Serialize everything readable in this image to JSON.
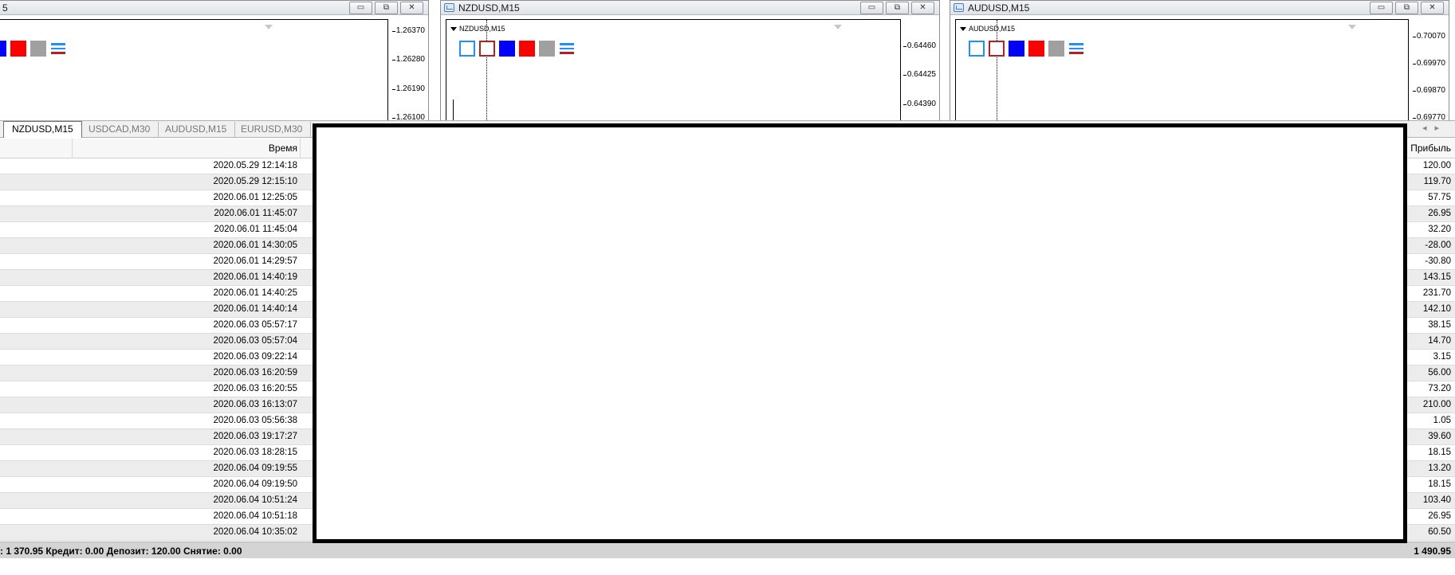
{
  "chart_windows": [
    {
      "title": "5",
      "label": "",
      "prices": [
        "1.26370",
        "1.26280",
        "1.26190",
        "1.26100"
      ]
    },
    {
      "title": "NZDUSD,M15",
      "label": "NZDUSD,M15",
      "prices": [
        "0.64460",
        "0.64425",
        "0.64390"
      ]
    },
    {
      "title": "AUDUSD,M15",
      "label": "AUDUSD,M15",
      "prices": [
        "0.70070",
        "0.69970",
        "0.69870",
        "0.69770"
      ]
    }
  ],
  "window_buttons": {
    "minimize": "▭",
    "restore": "⧉",
    "close": "✕"
  },
  "tabs": [
    {
      "label": "NZDUSD,M15",
      "active": true
    },
    {
      "label": "USDCAD,M30",
      "active": false
    },
    {
      "label": "AUDUSD,M15",
      "active": false
    },
    {
      "label": "EURUSD,M30",
      "active": false
    }
  ],
  "tab_scroll": {
    "left": "◂",
    "right": "▸"
  },
  "table": {
    "headers": {
      "time": "Время",
      "profit": "Прибыль"
    },
    "rows": [
      {
        "time": "2020.05.29 12:14:18",
        "profit": "120.00"
      },
      {
        "time": "2020.05.29 12:15:10",
        "profit": "119.70"
      },
      {
        "time": "2020.06.01 12:25:05",
        "profit": "57.75"
      },
      {
        "time": "2020.06.01 11:45:07",
        "profit": "26.95"
      },
      {
        "time": "2020.06.01 11:45:04",
        "profit": "32.20"
      },
      {
        "time": "2020.06.01 14:30:05",
        "profit": "-28.00"
      },
      {
        "time": "2020.06.01 14:29:57",
        "profit": "-30.80"
      },
      {
        "time": "2020.06.01 14:40:19",
        "profit": "143.15"
      },
      {
        "time": "2020.06.01 14:40:25",
        "profit": "231.70"
      },
      {
        "time": "2020.06.01 14:40:14",
        "profit": "142.10"
      },
      {
        "time": "2020.06.03 05:57:17",
        "profit": "38.15"
      },
      {
        "time": "2020.06.03 05:57:04",
        "profit": "14.70"
      },
      {
        "time": "2020.06.03 09:22:14",
        "profit": "3.15"
      },
      {
        "time": "2020.06.03 16:20:59",
        "profit": "56.00"
      },
      {
        "time": "2020.06.03 16:20:55",
        "profit": "73.20"
      },
      {
        "time": "2020.06.03 16:13:07",
        "profit": "210.00"
      },
      {
        "time": "2020.06.03 05:56:38",
        "profit": "1.05"
      },
      {
        "time": "2020.06.03 19:17:27",
        "profit": "39.60"
      },
      {
        "time": "2020.06.03 18:28:15",
        "profit": "18.15"
      },
      {
        "time": "2020.06.04 09:19:55",
        "profit": "13.20"
      },
      {
        "time": "2020.06.04 09:19:50",
        "profit": "18.15"
      },
      {
        "time": "2020.06.04 10:51:24",
        "profit": "103.40"
      },
      {
        "time": "2020.06.04 10:51:18",
        "profit": "26.95"
      },
      {
        "time": "2020.06.04 10:35:02",
        "profit": "60.50"
      }
    ]
  },
  "status": {
    "text": ": 1 370.95  Кредит: 0.00  Депозит: 120.00  Снятие: 0.00",
    "total": "1 490.95"
  }
}
